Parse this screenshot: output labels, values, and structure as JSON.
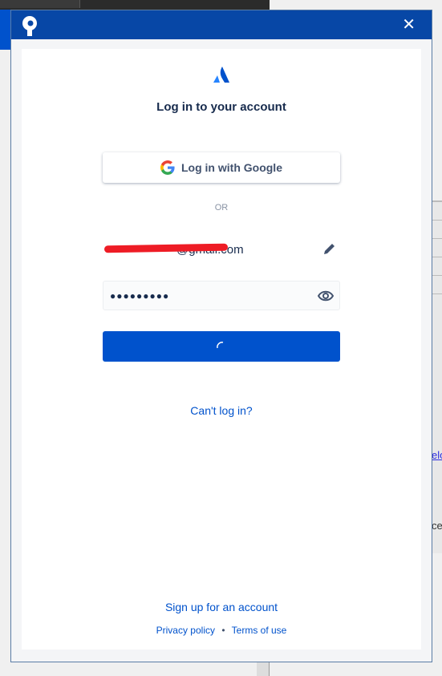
{
  "background": {
    "link_fragment": "elo",
    "text_fragment": "ce"
  },
  "dialog": {
    "close_label": "✕",
    "title": "Log in to your account",
    "google_button": "Log in with Google",
    "separator": "OR",
    "email_value": "@gmail.com",
    "password_value": "●●●●●●●●●",
    "cant_login": "Can't log in?",
    "signup": "Sign up for an account",
    "privacy": "Privacy policy",
    "bullet": "•",
    "terms": "Terms of use"
  },
  "colors": {
    "header": "#0747a6",
    "primary": "#0052cc",
    "redaction": "#ee1c25"
  }
}
